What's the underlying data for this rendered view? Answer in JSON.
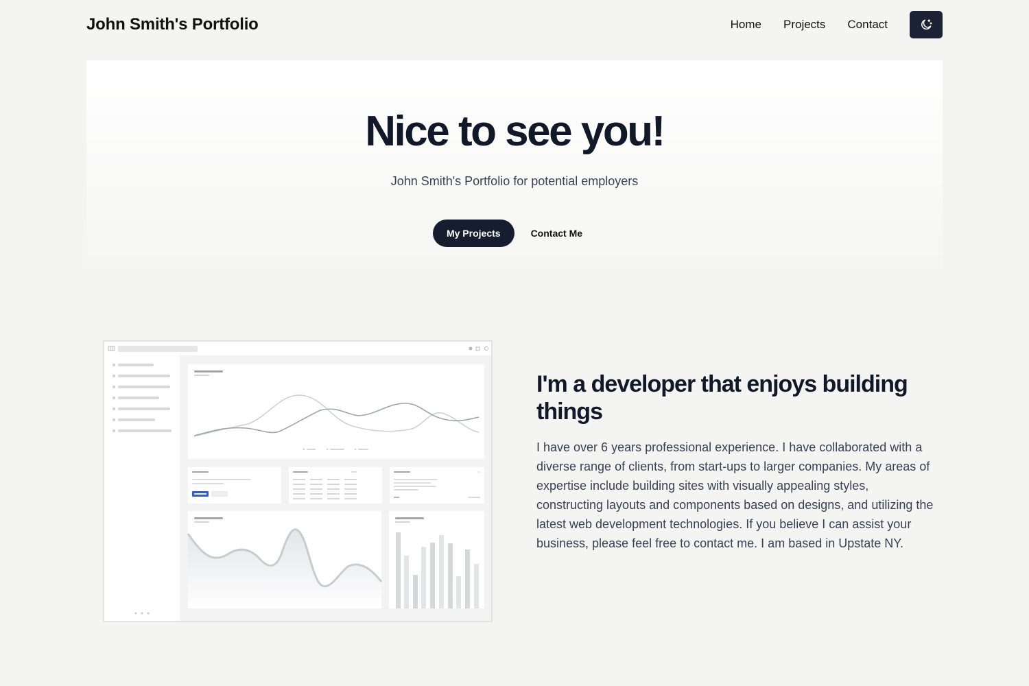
{
  "header": {
    "site_title": "John Smith's Portfolio",
    "nav": [
      "Home",
      "Projects",
      "Contact"
    ],
    "theme_toggle_icon": "moon-stars-icon"
  },
  "hero": {
    "title": "Nice to see you!",
    "subtitle": "John Smith's Portfolio for potential employers",
    "primary_button": "My Projects",
    "secondary_button": "Contact Me"
  },
  "about": {
    "heading": "I'm a developer that enjoys building things",
    "body": "I have over 6 years professional experience. I have collaborated with a diverse range of clients, from start-ups to larger companies. My areas of expertise include building sites with visually appealing styles, constructing layouts and components based on designs, and utilizing the latest web development technologies. If you believe I can assist your business, please feel free to contact me. I am based in Upstate NY."
  },
  "colors": {
    "page_bg": "#f4f4f3",
    "dark": "#151d2e",
    "accent_blue": "#2e5bd8"
  }
}
